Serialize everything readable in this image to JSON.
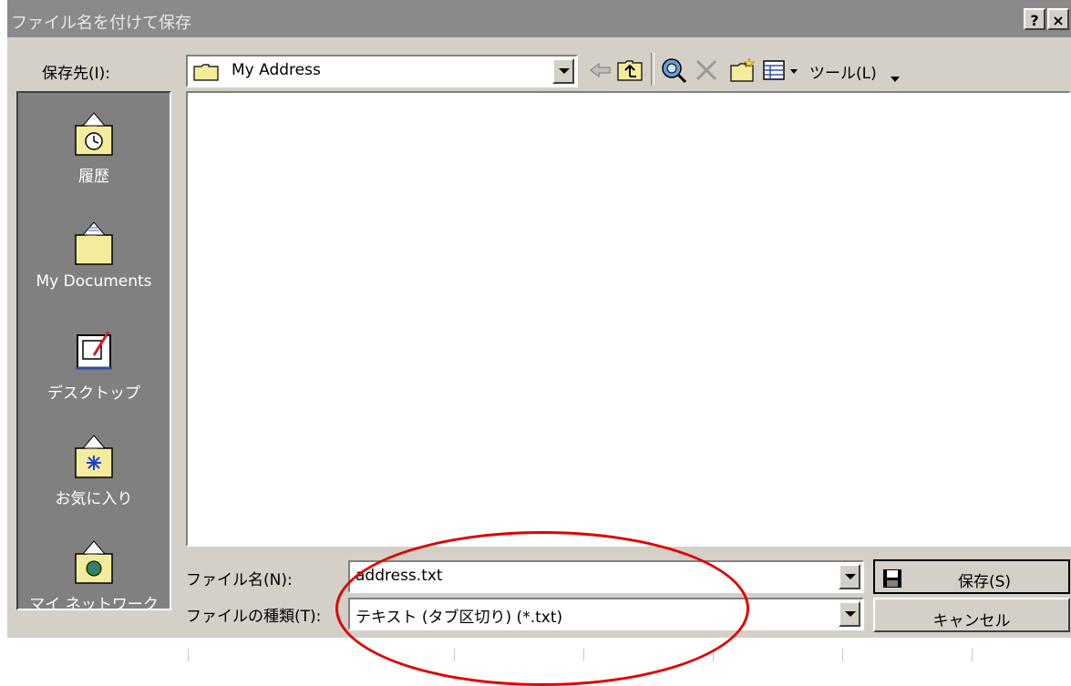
{
  "window": {
    "title": "ファイル名を付けて保存",
    "help_label": "?",
    "close_label": "×"
  },
  "save_in": {
    "label": "保存先(I):",
    "value": "My Address"
  },
  "toolbar": {
    "tools_label": "ツール(L)",
    "icons": [
      "back-icon",
      "up-folder-icon",
      "search-web-icon",
      "delete-icon",
      "new-folder-icon",
      "view-menu-icon"
    ]
  },
  "places": [
    {
      "label": "履歴",
      "icon": "history-icon"
    },
    {
      "label": "My Documents",
      "icon": "my-documents-icon"
    },
    {
      "label": "デスクトップ",
      "icon": "desktop-icon"
    },
    {
      "label": "お気に入り",
      "icon": "favorites-icon"
    },
    {
      "label": "マイ ネットワーク",
      "icon": "network-icon"
    }
  ],
  "filename": {
    "label": "ファイル名(N):",
    "value": "address.txt"
  },
  "filetype": {
    "label": "ファイルの種類(T):",
    "value": "テキスト (タブ区切り) (*.txt)"
  },
  "buttons": {
    "save": "保存(S)",
    "cancel": "キャンセル"
  },
  "colors": {
    "annotation": "#e00000",
    "titlebar": "#8a8a8a",
    "dialog_bg": "#d4d0c8"
  }
}
